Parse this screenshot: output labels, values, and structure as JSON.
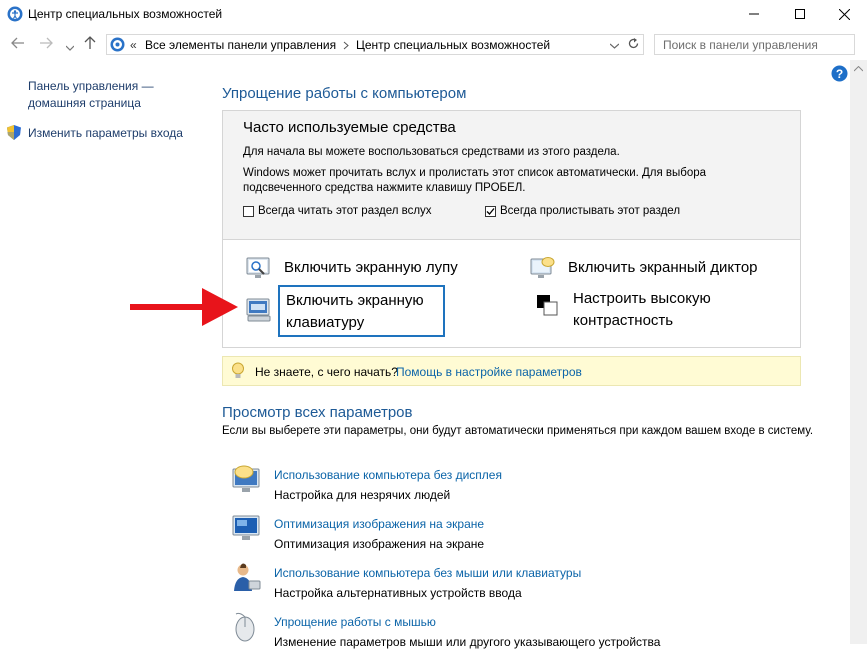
{
  "window": {
    "title": "Центр специальных возможностей",
    "controls": [
      "minimize",
      "maximize",
      "close"
    ]
  },
  "nav": {
    "breadcrumb_prefix": "«",
    "breadcrumb": [
      "Все элементы панели управления",
      "Центр специальных возможностей"
    ],
    "search_placeholder": "Поиск в панели управления"
  },
  "sidebar": {
    "home_link_line1": "Панель управления —",
    "home_link_line2": "домашняя страница",
    "signin_link": "Изменить параметры входа"
  },
  "main": {
    "ease_title": "Упрощение работы с компьютером",
    "freq_title": "Часто используемые средства",
    "freq_desc1": "Для начала вы можете воспользоваться средствами из этого раздела.",
    "freq_desc2_line1": "Windows может прочитать вслух и пролистать этот список автоматически. Для выбора",
    "freq_desc2_line2": "подсвеченного средства нажмите клавишу ПРОБЕЛ.",
    "cb_read_label": "Всегда читать этот раздел вслух",
    "cb_read_checked": false,
    "cb_scroll_label": "Всегда пролистывать этот раздел",
    "cb_scroll_checked": true,
    "tools": {
      "magnifier": "Включить экранную лупу",
      "narrator": "Включить экранный диктор",
      "keyboard_line1": "Включить экранную",
      "keyboard_line2": "клавиатуру",
      "contrast_line1": "Настроить высокую",
      "contrast_line2": "контрастность"
    },
    "hint_text": "Не знаете, с чего начать?",
    "hint_link": "Помощь в настройке параметров",
    "all_title": "Просмотр всех параметров",
    "all_desc": "Если вы выберете эти параметры, они будут автоматически применяться при каждом вашем входе в систему.",
    "categories": [
      {
        "link": "Использование компьютера без дисплея",
        "desc": "Настройка для незрячих людей"
      },
      {
        "link": "Оптимизация изображения на экране",
        "desc": "Оптимизация изображения на экране"
      },
      {
        "link": "Использование компьютера без мыши или клавиатуры",
        "desc": "Настройка альтернативных устройств ввода"
      },
      {
        "link": "Упрощение работы с мышью",
        "desc": "Изменение параметров мыши или другого указывающего устройства"
      }
    ]
  },
  "colors": {
    "link": "#0b64a8",
    "section_title": "#1e5a96",
    "hint_background": "#fffbd4",
    "annotation_arrow": "#e8141b",
    "focus_border": "#1e73be"
  }
}
